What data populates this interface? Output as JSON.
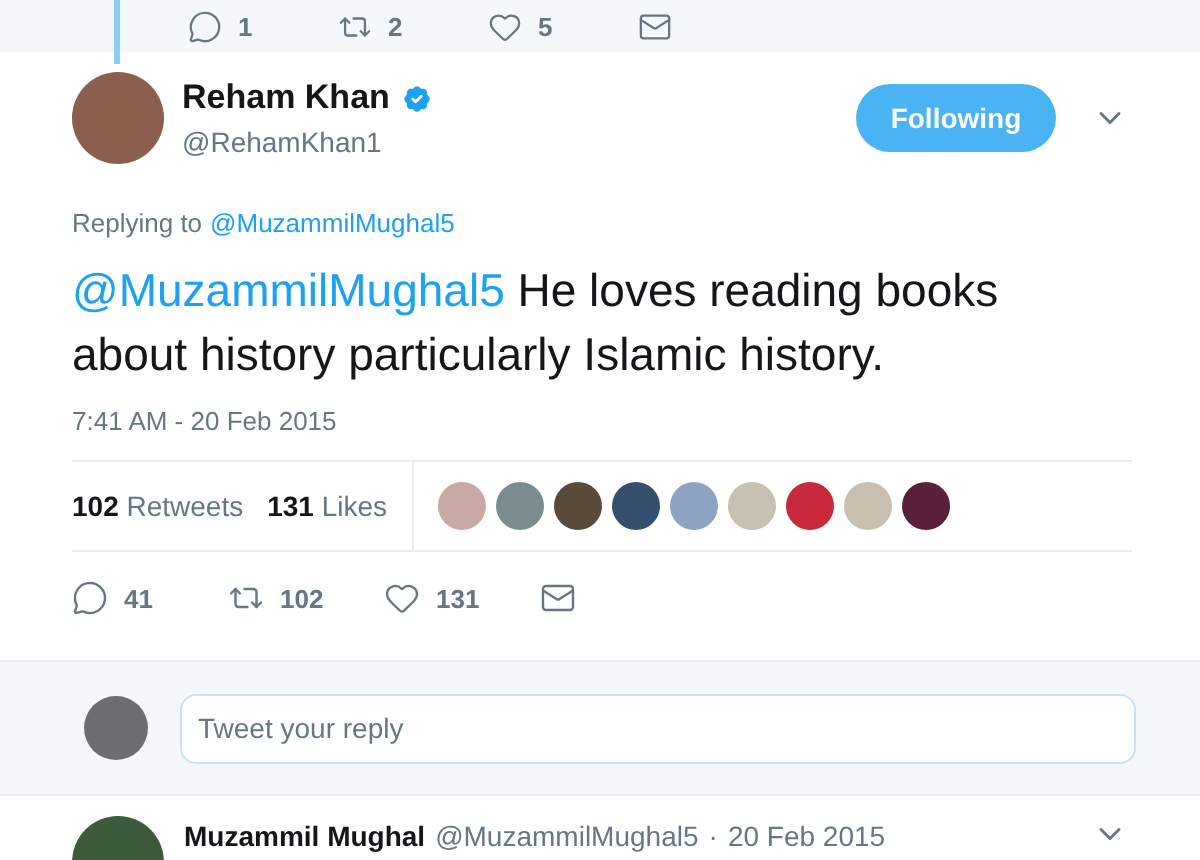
{
  "previous_tweet_actions": [
    {
      "kind": "reply",
      "count": "1"
    },
    {
      "kind": "retweet",
      "count": "2"
    },
    {
      "kind": "like",
      "count": "5"
    },
    {
      "kind": "message"
    }
  ],
  "tweet": {
    "name": "Reham Khan",
    "verified": true,
    "handle": "@RehamKhan1",
    "follow_button": "Following",
    "replying_label": "Replying to",
    "replying_to": "@MuzammilMughal5",
    "mention": "@MuzammilMughal5",
    "text": "He loves reading books about history particularly Islamic history.",
    "timestamp": "7:41 AM - 20 Feb 2015",
    "stats": [
      {
        "count": "102",
        "label": "Retweets"
      },
      {
        "count": "131",
        "label": "Likes"
      }
    ],
    "actions": [
      {
        "kind": "reply",
        "count": "41"
      },
      {
        "kind": "retweet",
        "count": "102"
      },
      {
        "kind": "like",
        "count": "131"
      },
      {
        "kind": "message"
      }
    ]
  },
  "reply_box": {
    "placeholder": "Tweet your reply"
  },
  "next_tweet": {
    "name": "Muzammil Mughal",
    "handle": "@MuzammilMughal5",
    "separator": "·",
    "date": "20 Feb 2015"
  }
}
